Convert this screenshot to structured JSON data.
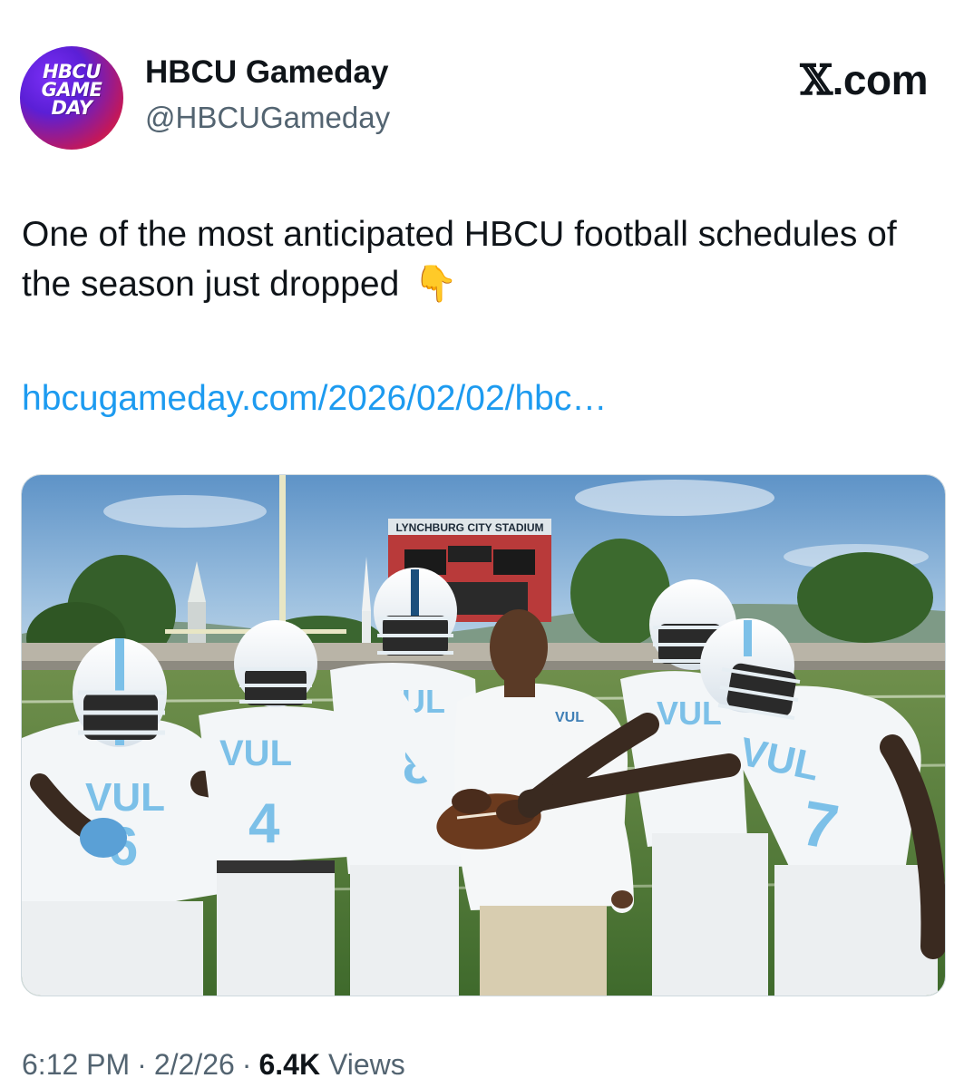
{
  "author": {
    "display_name": "HBCU Gameday",
    "handle": "@HBCUGameday",
    "avatar_lines": [
      "HBCU",
      "GAME",
      "DAY"
    ]
  },
  "site_mark": {
    "logo_glyph": "𝕏",
    "suffix": ".com"
  },
  "tweet": {
    "text": "One of the most anticipated HBCU football schedules of the season just dropped",
    "emoji": "👇",
    "emoji_icon": "backhand-index-pointing-down-icon",
    "link": "hbcugameday.com/2026/02/02/hbc…"
  },
  "media": {
    "scoreboard_text": "LYNCHBURG CITY STADIUM",
    "jersey_text": "VUL",
    "jersey_numbers": [
      "6",
      "4",
      "8",
      "",
      "7"
    ],
    "polo_text": "VUL"
  },
  "meta": {
    "time": "6:12 PM",
    "separator": "·",
    "date": "2/2/26",
    "views_count": "6.4K",
    "views_label": "Views"
  },
  "colors": {
    "link": "#1d9bf0",
    "secondary_text": "#536471",
    "primary_text": "#0f1419",
    "jersey_blue": "#7cc0e8"
  }
}
